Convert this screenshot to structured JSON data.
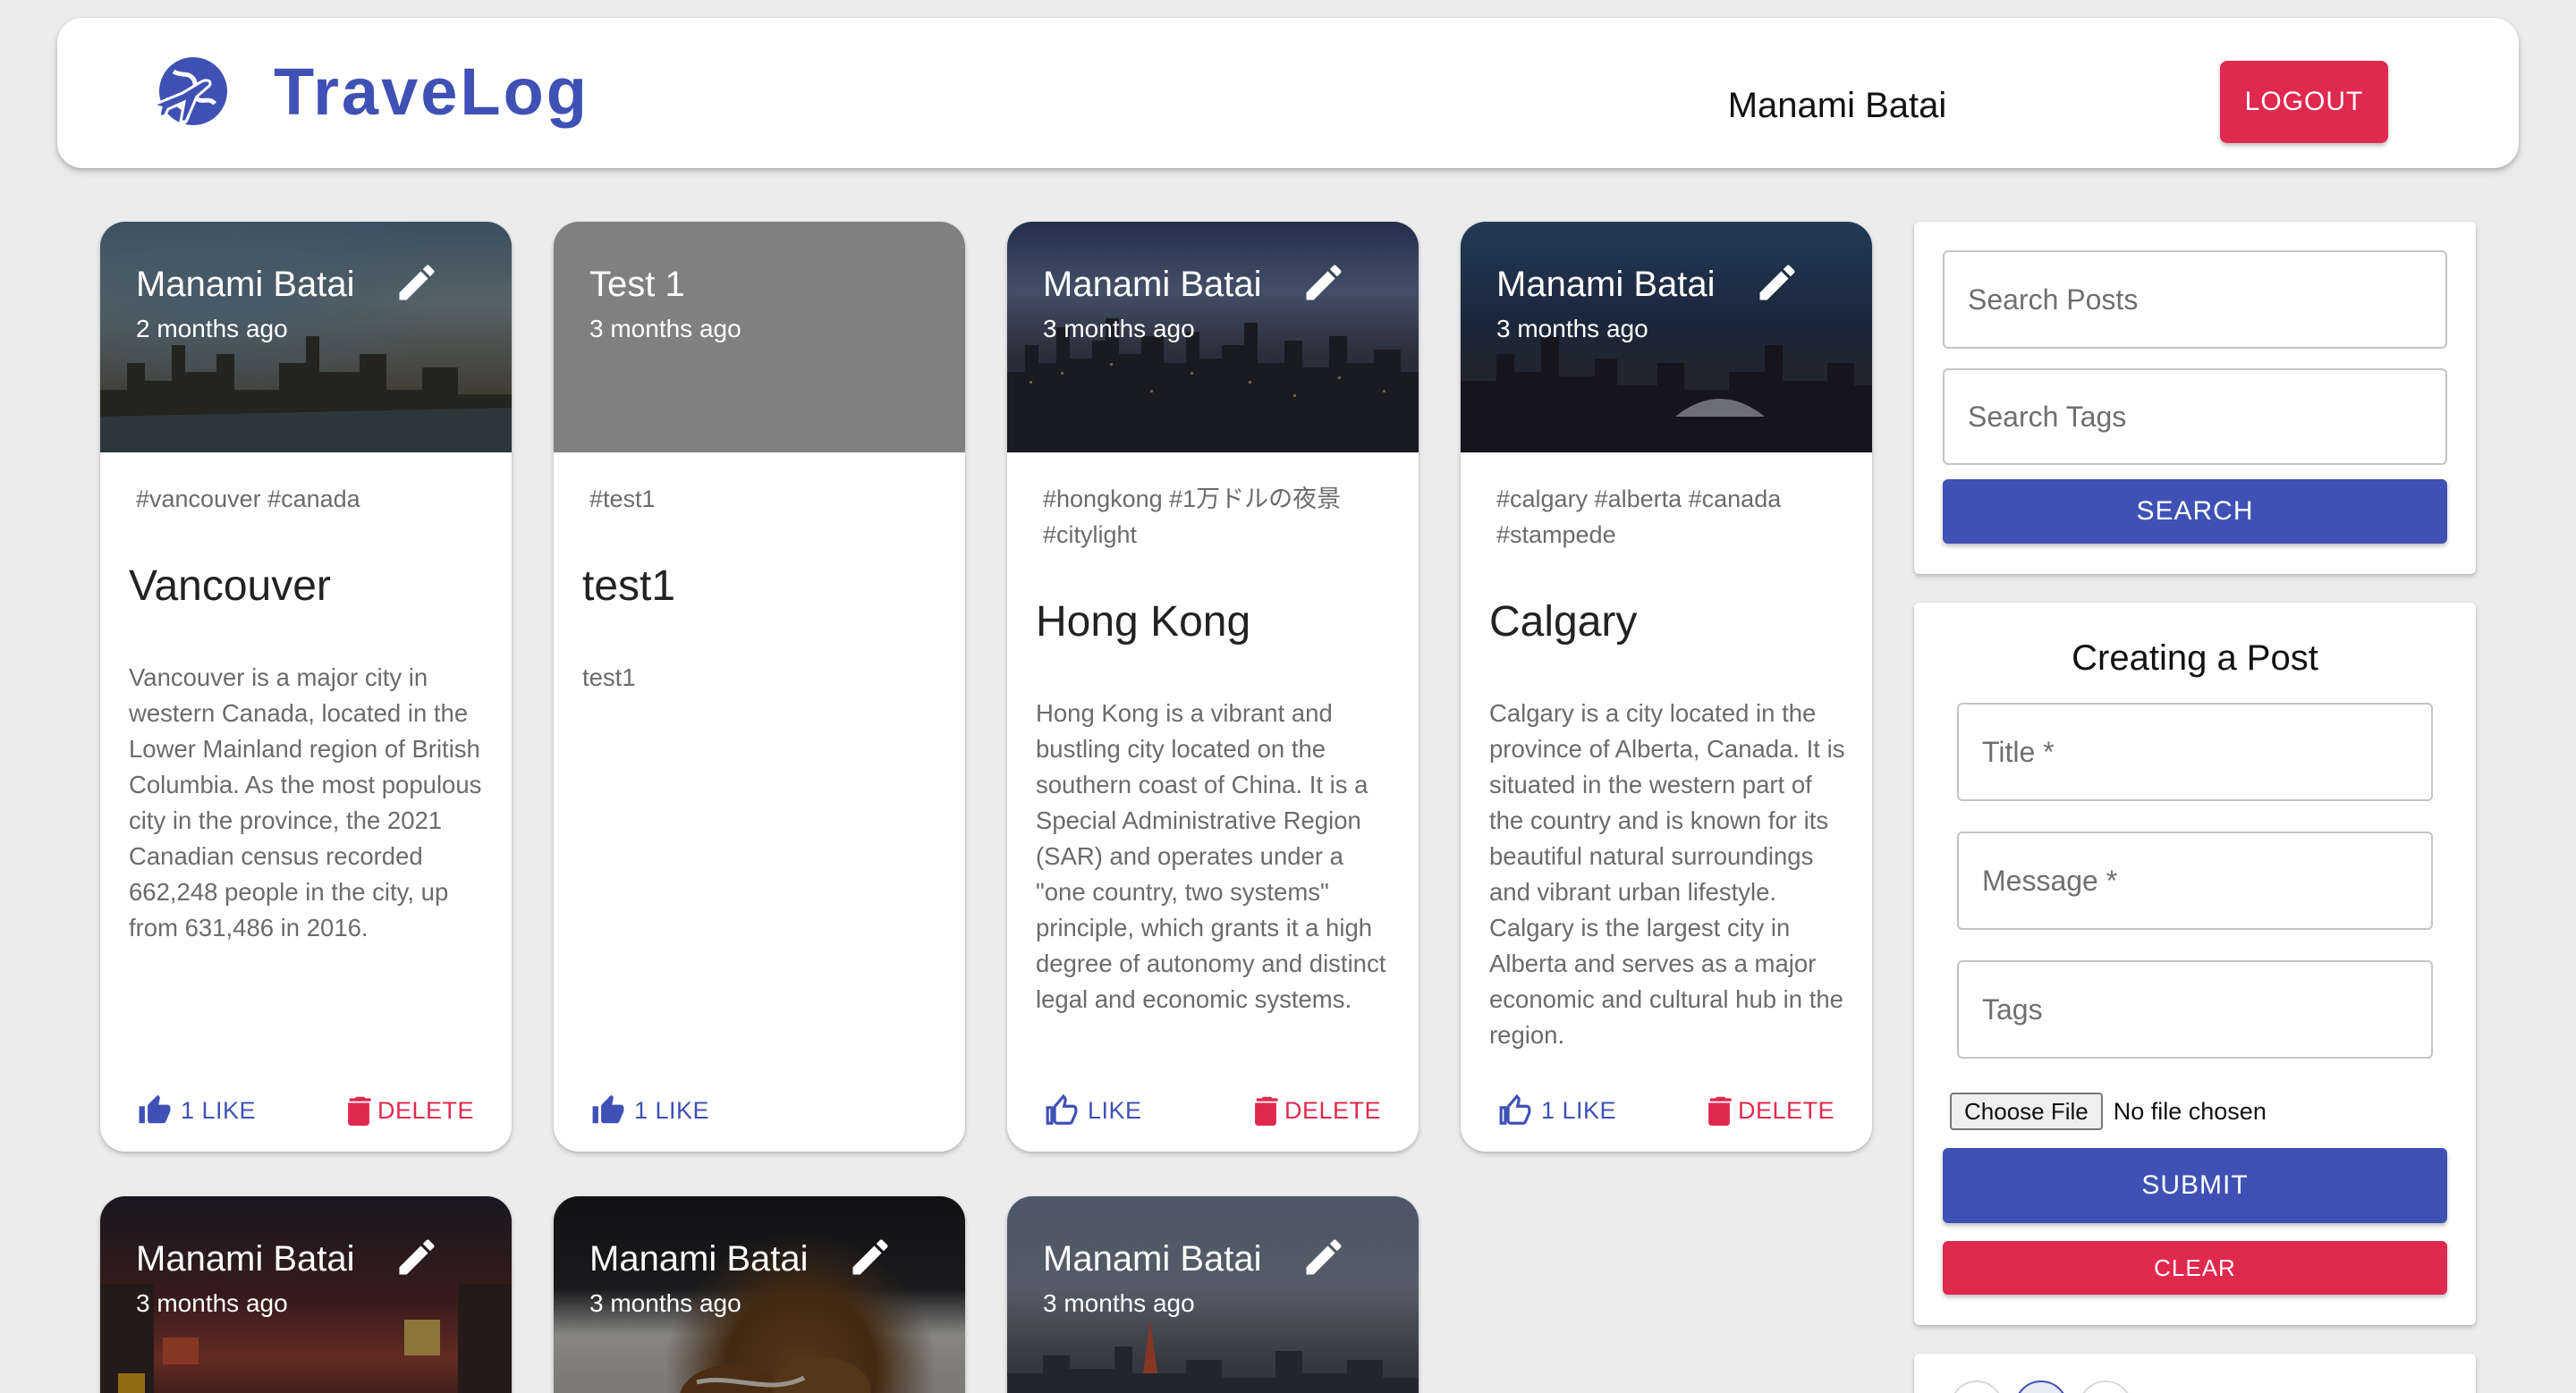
{
  "app": {
    "brand": "TraveLog",
    "user_name": "Manami Batai",
    "logout_label": "LOGOUT"
  },
  "posts": [
    {
      "owner": "Manami Batai",
      "time": "2 months ago",
      "tags": "#vancouver #canada",
      "title": "Vancouver",
      "message": "Vancouver is a major city in western Canada, located in the Lower Mainland region of British Columbia. As the most populous city in the province, the 2021 Canadian census recorded 662,248 people in the city, up from 631,486 in 2016.",
      "like_label": "1 LIKE",
      "delete_label": "DELETE"
    },
    {
      "owner": "Test 1",
      "time": "3 months ago",
      "tags": "#test1",
      "title": "test1",
      "message": "test1",
      "like_label": "1 LIKE"
    },
    {
      "owner": "Manami Batai",
      "time": "3 months ago",
      "tags": "#hongkong #1万ドルの夜景 #citylight",
      "title": "Hong Kong",
      "message": "Hong Kong is a vibrant and bustling city located on the southern coast of China. It is a Special Administrative Region (SAR) and operates under a \"one country, two systems\" principle, which grants it a high degree of autonomy and distinct legal and economic systems.",
      "like_label": "LIKE",
      "delete_label": "DELETE"
    },
    {
      "owner": "Manami Batai",
      "time": "3 months ago",
      "tags": "#calgary #alberta #canada #stampede",
      "title": "Calgary",
      "message": "Calgary is a city located in the province of Alberta, Canada. It is situated in the western part of the country and is known for its beautiful natural surroundings and vibrant urban lifestyle. Calgary is the largest city in Alberta and serves as a major economic and cultural hub in the region.",
      "like_label": "1 LIKE",
      "delete_label": "DELETE"
    },
    {
      "owner": "Manami Batai",
      "time": "3 months ago"
    },
    {
      "owner": "Manami Batai",
      "time": "3 months ago"
    },
    {
      "owner": "Manami Batai",
      "time": "3 months ago"
    }
  ],
  "search": {
    "posts_placeholder": "Search Posts",
    "tags_placeholder": "Search Tags",
    "button_label": "SEARCH"
  },
  "form": {
    "title": "Creating a Post",
    "title_placeholder": "Title *",
    "message_placeholder": "Message *",
    "tags_placeholder": "Tags",
    "choose_file_label": "Choose File",
    "no_file_label": "No file chosen",
    "submit_label": "SUBMIT",
    "clear_label": "CLEAR"
  },
  "colors": {
    "primary": "#3f51b5",
    "danger": "#e0294f",
    "background": "#ececec"
  }
}
